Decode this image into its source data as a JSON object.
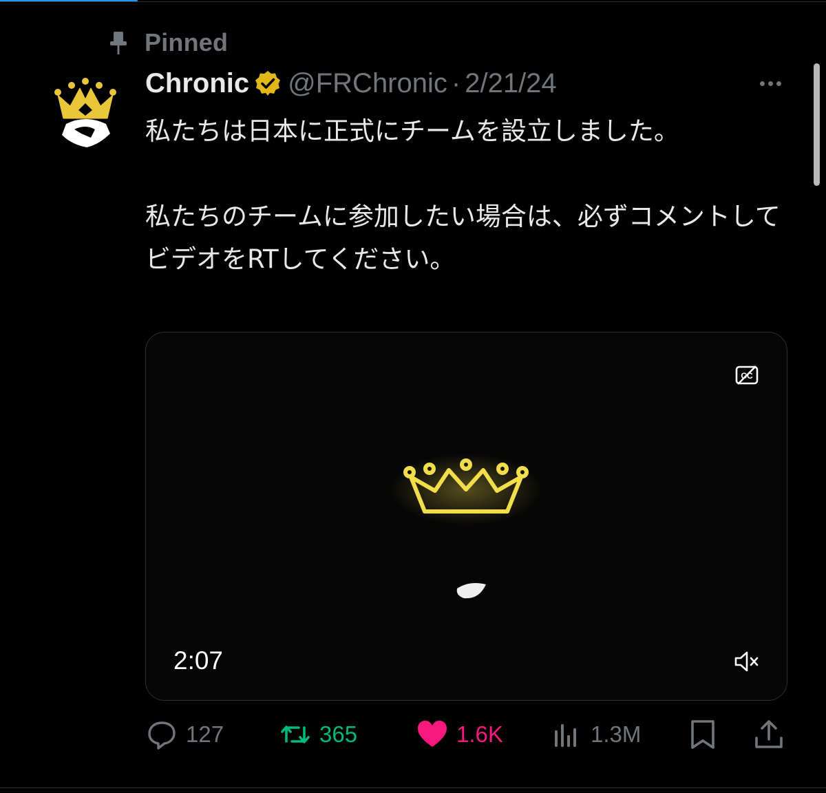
{
  "pinned": {
    "label": "Pinned",
    "icon": "pin-icon"
  },
  "author": {
    "display_name": "Chronic",
    "handle": "@FRChronic",
    "separator": "·",
    "date": "2/21/24",
    "verified": true,
    "avatar_icon": "crown-logo"
  },
  "tweet": {
    "paragraphs": [
      "私たちは日本に正式にチームを設立しました。",
      "私たちのチームに参加したい場合は、必ずコメントしてビデオをRTしてください。"
    ]
  },
  "video": {
    "duration": "2:07",
    "captions_icon": "closed-captions-icon",
    "mute_icon": "speaker-muted-icon"
  },
  "actions": {
    "replies": "127",
    "retweets": "365",
    "likes": "1.6K",
    "views": "1.3M",
    "liked": true
  },
  "colors": {
    "background": "#000000",
    "text": "#e7e9ea",
    "muted": "#71767b",
    "retweet": "#00ba7c",
    "like": "#f91880",
    "verified_gold": "#e2b719",
    "accent": "#1d9bf0"
  }
}
